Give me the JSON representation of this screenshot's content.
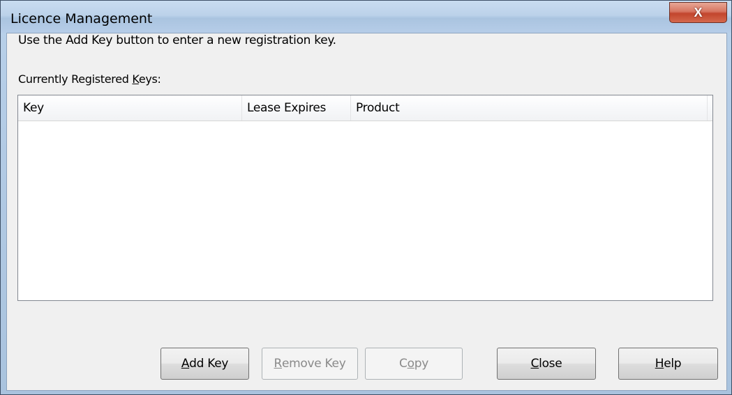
{
  "window": {
    "title": "Licence Management",
    "close_glyph": "X"
  },
  "dialog": {
    "intro_text": "Use the Add Key button to enter a new registration key.",
    "keys_label_pre": "Currently Registered ",
    "keys_label_mnemonic": "K",
    "keys_label_post": "eys:"
  },
  "table": {
    "columns": [
      "Key",
      "Lease Expires",
      "Product"
    ],
    "rows": []
  },
  "buttons": {
    "add_key": {
      "mnemonic": "A",
      "rest": "dd Key",
      "enabled": true
    },
    "remove_key": {
      "mnemonic": "R",
      "rest": "emove Key",
      "enabled": false
    },
    "copy": {
      "pre": "C",
      "mnemonic": "o",
      "rest": "py",
      "enabled": false
    },
    "close": {
      "mnemonic": "C",
      "rest": "lose",
      "enabled": true
    },
    "help": {
      "mnemonic": "H",
      "rest": "elp",
      "enabled": true
    }
  }
}
